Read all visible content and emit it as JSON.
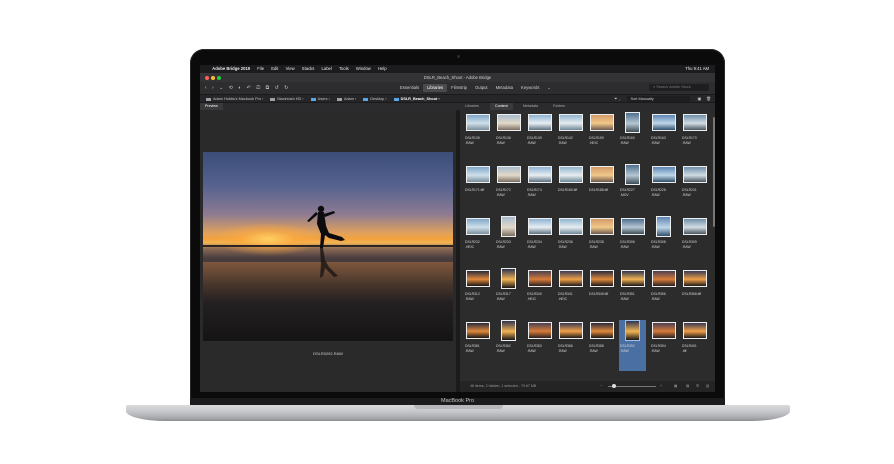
{
  "menubar": {
    "apple": "",
    "app": "Adobe Bridge 2019",
    "items": [
      "File",
      "Edit",
      "View",
      "Stacks",
      "Label",
      "Tools",
      "Window",
      "Help"
    ],
    "clock": "Thu 9:41 AM"
  },
  "window": {
    "title": "DSLR_Beach_Shoot - Adobe Bridge"
  },
  "workspaces": [
    "Essentials",
    "Libraries",
    "Filmstrip",
    "Output",
    "Metadata",
    "Keywords"
  ],
  "active_workspace": "Libraries",
  "search": {
    "placeholder": "Search Adobe Stock"
  },
  "breadcrumb": [
    "Adam Hobbs's Macbook Pro",
    "Macintosh HD",
    "Users",
    "Adam",
    "Desktop",
    "DSLR_Beach_Shoot"
  ],
  "sort": {
    "label": "Sort Manually"
  },
  "panels": {
    "preview": "Preview",
    "tabs": [
      "Libraries",
      "Content",
      "Metadata",
      "Folders"
    ]
  },
  "preview": {
    "filename": "DSLR0292.RAW"
  },
  "thumbnails": [
    {
      "name": "DSLR135",
      "ext": ".RAW"
    },
    {
      "name": "DSLR136",
      "ext": ".RAW"
    },
    {
      "name": "DSLR139",
      "ext": ".RAW"
    },
    {
      "name": "DSLR142",
      "ext": ".RAW"
    },
    {
      "name": "DSLR159",
      "ext": ".HEIC"
    },
    {
      "name": "DSLR160",
      "ext": ".RAW"
    },
    {
      "name": "DSLR163",
      "ext": ".RAW"
    },
    {
      "name": "DSLR170",
      "ext": ".RAW"
    },
    {
      "name": "DSLR171.tiff",
      "ext": ""
    },
    {
      "name": "DSLR172",
      "ext": ".RAW"
    },
    {
      "name": "DSLR174",
      "ext": ".RAW"
    },
    {
      "name": "DSLR180.tiff",
      "ext": ""
    },
    {
      "name": "DSLR188.tiff",
      "ext": ""
    },
    {
      "name": "DSLR227",
      "ext": ".MOV"
    },
    {
      "name": "DSLR228",
      "ext": ".RAW"
    },
    {
      "name": "DSLR231",
      "ext": ".RAW"
    },
    {
      "name": "DSLR232",
      "ext": ".HEIC"
    },
    {
      "name": "DSLR233",
      "ext": ".RAW"
    },
    {
      "name": "DSLR234",
      "ext": ".RAW"
    },
    {
      "name": "DSLR236",
      "ext": ".RAW"
    },
    {
      "name": "DSLR238",
      "ext": ".RAW"
    },
    {
      "name": "DSLR306",
      "ext": ".RAW"
    },
    {
      "name": "DSLR308",
      "ext": ".RAW"
    },
    {
      "name": "DSLR309",
      "ext": ".RAW"
    },
    {
      "name": "DSLR312",
      "ext": ".RAW"
    },
    {
      "name": "DSLR317",
      "ext": ".RAW"
    },
    {
      "name": "DSLR340",
      "ext": ".HEIC"
    },
    {
      "name": "DSLR341",
      "ext": ".HEIC"
    },
    {
      "name": "DSLR345.tiff",
      "ext": ""
    },
    {
      "name": "DSLR351",
      "ext": ".RAW"
    },
    {
      "name": "DSLR356",
      "ext": ".RAW"
    },
    {
      "name": "DSLR368.tiff",
      "ext": ""
    },
    {
      "name": "DSLR381",
      "ext": ".RAW"
    },
    {
      "name": "DSLR382",
      "ext": ".RAW"
    },
    {
      "name": "DSLR383",
      "ext": ".RAW"
    },
    {
      "name": "DSLR386",
      "ext": ".RAW"
    },
    {
      "name": "DSLR388",
      "ext": ".RAW"
    },
    {
      "name": "DSLR392",
      "ext": ".RAW"
    },
    {
      "name": "DSLR394",
      "ext": ".RAW"
    },
    {
      "name": "DSLR401",
      "ext": ".tiff"
    }
  ],
  "status": {
    "text": "46 items, 2 hidden, 1 selected - 79.67 MB"
  },
  "device": {
    "label": "MacBook Pro"
  },
  "colors": {
    "accent": "#5aa7e6",
    "selection": "#4a6fa3",
    "traffic_red": "#ff5f57",
    "traffic_yellow": "#febc2e",
    "traffic_green": "#28c840"
  }
}
